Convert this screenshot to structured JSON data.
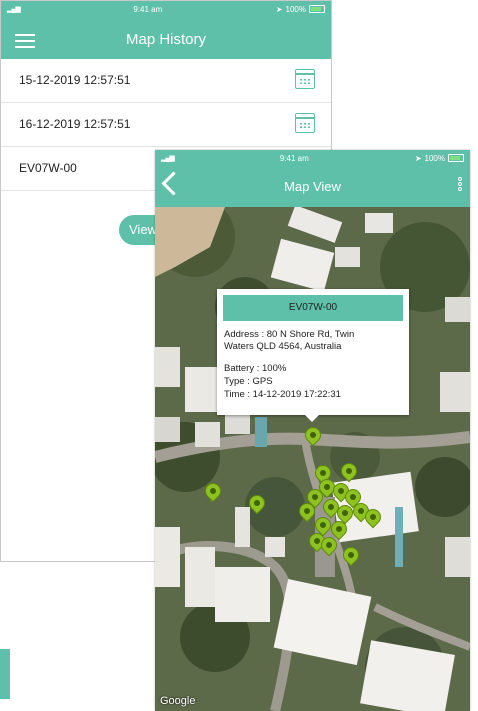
{
  "status_bar": {
    "time": "9:41 am",
    "battery": "100%"
  },
  "history_screen": {
    "title": "Map History",
    "rows": [
      "15-12-2019 12:57:51",
      "16-12-2019 12:57:51",
      "EV07W-00"
    ],
    "view_button": "View"
  },
  "map_screen": {
    "title": "Map View",
    "map_attribution": "Google",
    "popup": {
      "device": "EV07W-00",
      "address": [
        "Address : 80 N Shore Rd, Twin",
        "Waters QLD 4564, Australia"
      ],
      "battery": "Battery : 100%",
      "type": "Type : GPS",
      "time": "Time : 14-12-2019 17:22:31"
    },
    "marker_icon": "location-pin-icon",
    "marker_color": "#8ec220"
  },
  "colors": {
    "accent": "#5ec0a9"
  }
}
